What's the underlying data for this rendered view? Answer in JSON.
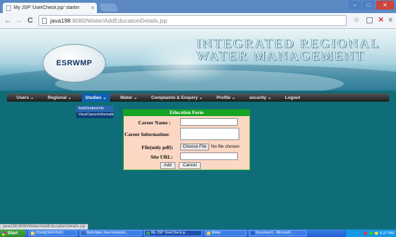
{
  "browser": {
    "tab_title": "My JSP 'UserCheck.jsp' startin",
    "tab_close": "×",
    "url_host": "java198",
    "url_rest": ":8080/Water/AddEducationDetails.jsp",
    "back": "←",
    "forward": "→",
    "reload": "C",
    "star": "☆",
    "menu": "≡",
    "win_min": "–",
    "win_max": "□",
    "win_close": "✕"
  },
  "banner": {
    "logo_text": "ESRWMP",
    "title_line1": "INTEGRATED REGIONAL",
    "title_line2": "WATER MANAGEMENT"
  },
  "menu": {
    "items": [
      {
        "label": "Users ⌄",
        "name": "menu-users"
      },
      {
        "label": "Regional ⌄",
        "name": "menu-regional"
      },
      {
        "label": "Studies ⌄",
        "name": "menu-studies"
      },
      {
        "label": "Water ⌄",
        "name": "menu-water"
      },
      {
        "label": "Complaints & Enquiry ⌄",
        "name": "menu-complaints"
      },
      {
        "label": "Profile ⌄",
        "name": "menu-profile"
      },
      {
        "label": "security ⌄",
        "name": "menu-security"
      },
      {
        "label": "Logout",
        "name": "menu-logout"
      }
    ],
    "dropdown": [
      "AddStudiesInfo",
      "ViewCareerInformation"
    ]
  },
  "form": {
    "heading": "Education Form",
    "career_name_label": "Career Name :",
    "career_name_value": "",
    "career_info_label": "Career Information:",
    "career_info_value": "",
    "file_label": "File(only pdf):",
    "file_button": "Choose File",
    "file_status": "No file chosen",
    "site_url_label": "Site URL:",
    "site_url_value": "",
    "add_button": "Add",
    "cancel_button": "Cancel"
  },
  "status_url": "java198:8080/Water/AddEducationDetails.jsp",
  "taskbar": {
    "start": "Start",
    "tasks": [
      {
        "label": "ISSA@SERVER3",
        "color": "#f4d35e"
      },
      {
        "label": "MyEclipse Java Enterpris...",
        "color": "#4e5fa6"
      },
      {
        "label": "My JSP 'UserCheck.js...",
        "color": "#3aa35b"
      },
      {
        "label": "Water",
        "color": "#f2c64b"
      },
      {
        "label": "Document1 - Microsoft ...",
        "color": "#2d5db3"
      }
    ],
    "clock": "5:27 PM"
  },
  "colors": {
    "page_background": "#0f6d79",
    "form_background": "#fbd7c4",
    "form_header": "#17a324",
    "menu_active": "#0f5fb3"
  }
}
